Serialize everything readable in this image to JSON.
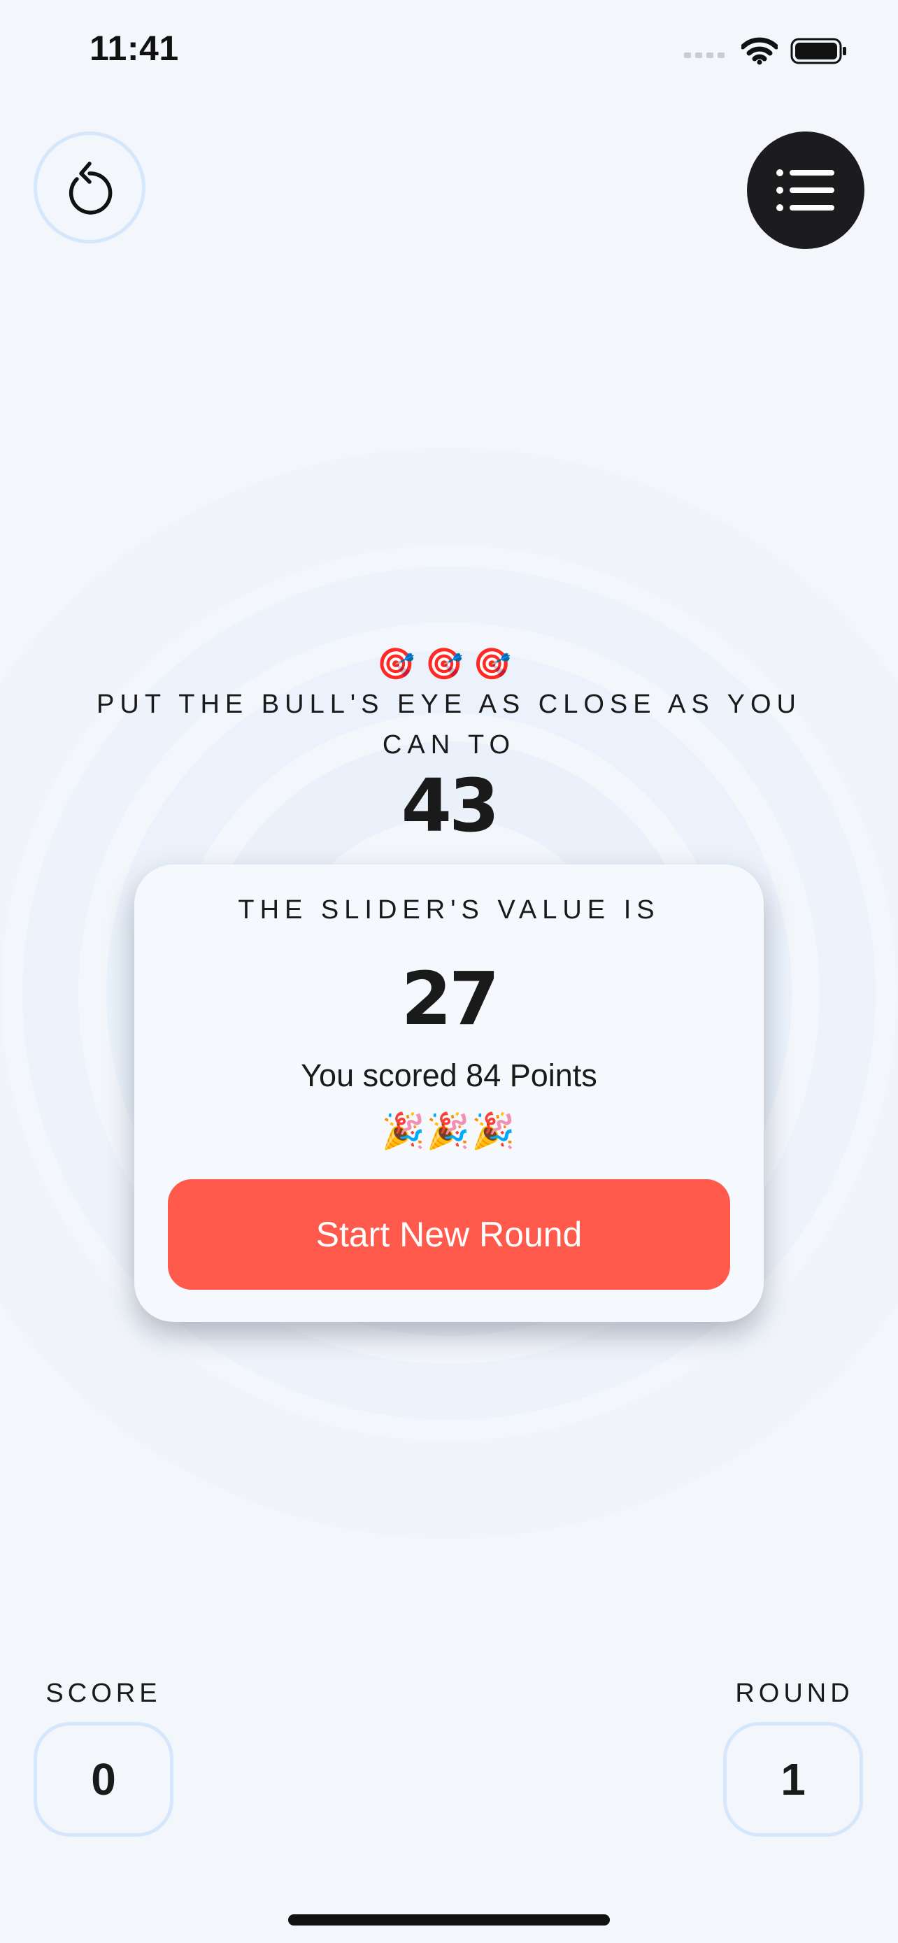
{
  "status_bar": {
    "time": "11:41"
  },
  "colors": {
    "background": "#f3f7fc",
    "accent": "#ff5a4c",
    "ring": "#e8f0fb",
    "dark_button": "#1c1c1e",
    "outline": "#d6e6fb"
  },
  "icons": {
    "restart": "counterclockwise-arrow-icon",
    "leaderboard": "list-icon",
    "target": "bullseye-dart-icon",
    "celebration": "party-popper-icon"
  },
  "instructions": {
    "emojis": "🎯🎯🎯",
    "text": "PUT THE BULL'S EYE AS CLOSE AS YOU CAN TO",
    "target_value": "43"
  },
  "result": {
    "heading": "THE SLIDER'S VALUE IS",
    "slider_value": "27",
    "score_message": "You scored 84 Points",
    "emojis": "🎉🎉🎉",
    "button_label": "Start New Round"
  },
  "stats": {
    "score_label": "SCORE",
    "score_value": "0",
    "round_label": "ROUND",
    "round_value": "1"
  }
}
